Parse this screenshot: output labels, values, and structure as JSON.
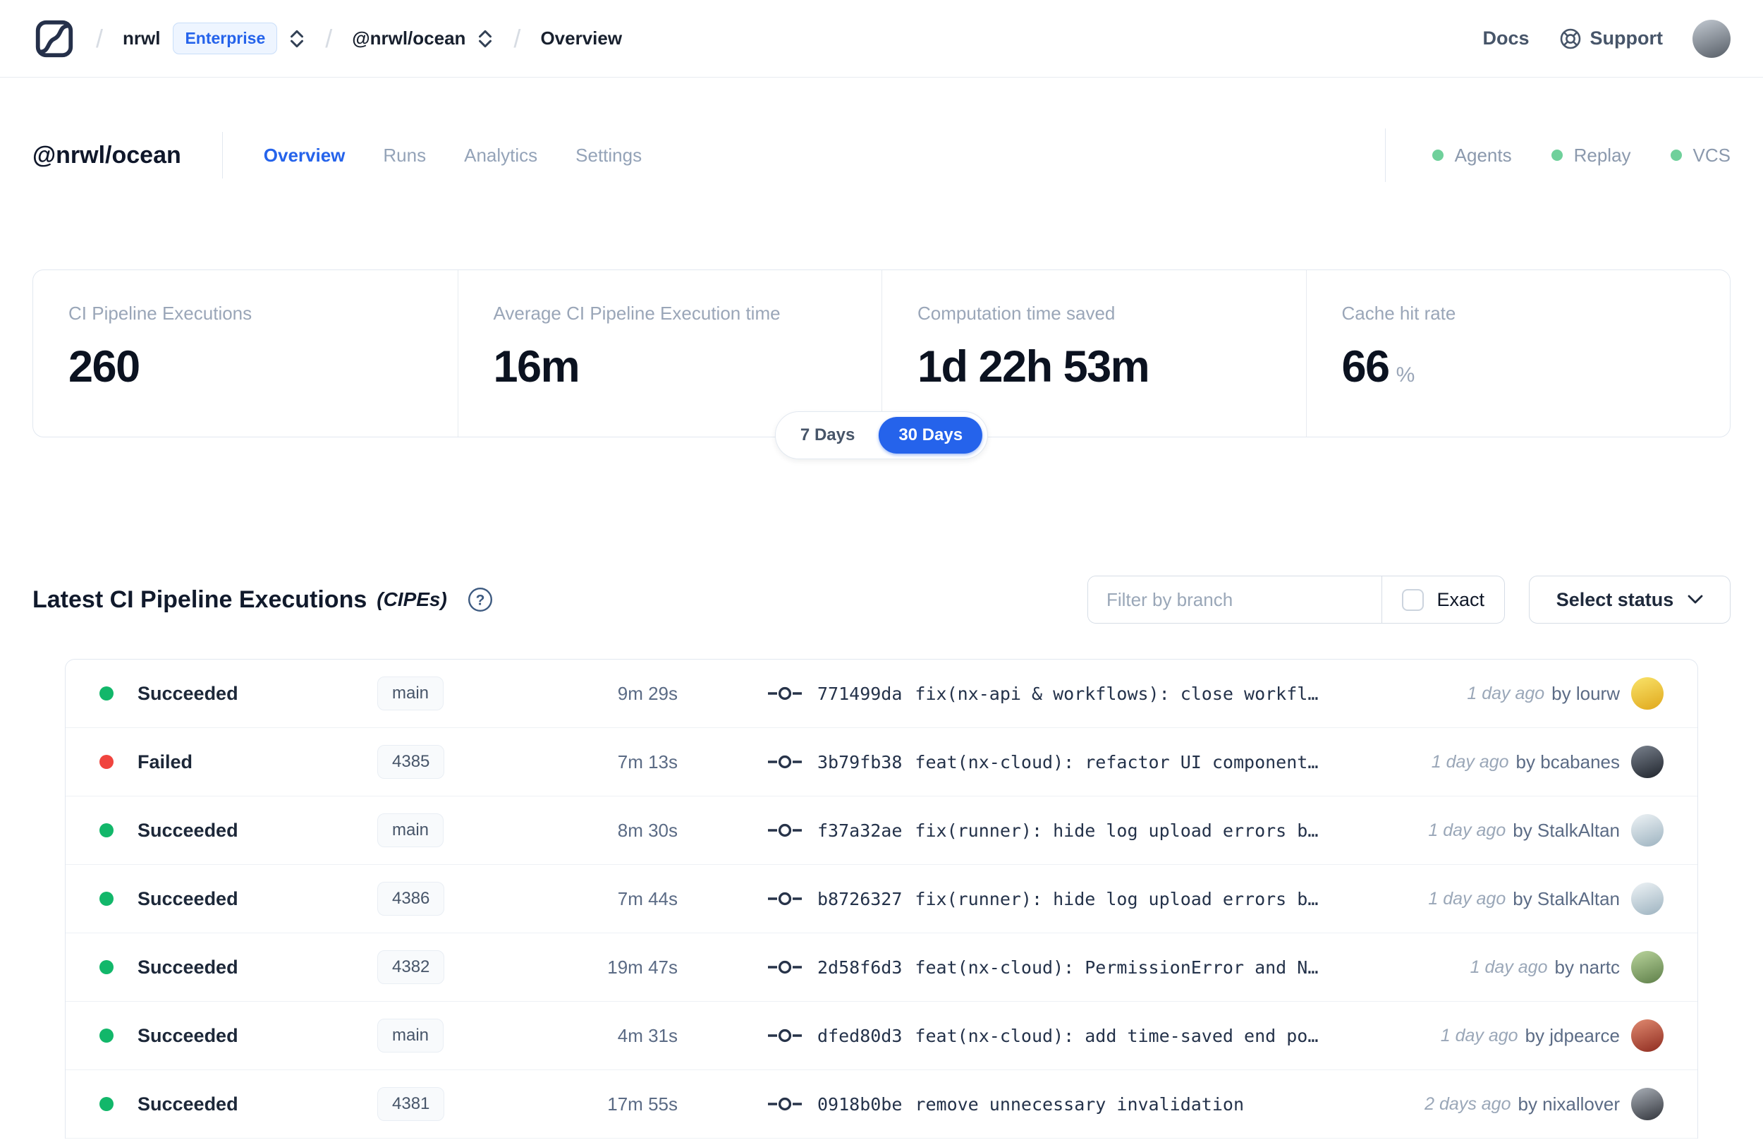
{
  "topbar": {
    "breadcrumb": {
      "separator": "/",
      "org": "nrwl",
      "plan_badge": "Enterprise",
      "workspace": "@nrwl/ocean",
      "page": "Overview"
    },
    "docs_label": "Docs",
    "support_label": "Support",
    "user_avatar_colors": [
      "#c3cad2",
      "#565d66"
    ]
  },
  "workspace_header": {
    "title": "@nrwl/ocean",
    "tabs": [
      {
        "label": "Overview",
        "active": true
      },
      {
        "label": "Runs",
        "active": false
      },
      {
        "label": "Analytics",
        "active": false
      },
      {
        "label": "Settings",
        "active": false
      }
    ],
    "features": [
      {
        "label": "Agents"
      },
      {
        "label": "Replay"
      },
      {
        "label": "VCS"
      }
    ],
    "feature_dot_color": "#6fd09b"
  },
  "stats": {
    "cards": [
      {
        "label": "CI Pipeline Executions",
        "value": "260",
        "suffix": ""
      },
      {
        "label": "Average CI Pipeline Execution time",
        "value": "16m",
        "suffix": ""
      },
      {
        "label": "Computation time saved",
        "value": "1d 22h 53m",
        "suffix": ""
      },
      {
        "label": "Cache hit rate",
        "value": "66",
        "suffix": "%"
      }
    ],
    "range_toggle": {
      "options": [
        "7 Days",
        "30 Days"
      ],
      "selected": "30 Days"
    }
  },
  "cipe_section": {
    "title": "Latest CI Pipeline Executions",
    "title_suffix": "(CIPEs)",
    "filter": {
      "branch_placeholder": "Filter by branch",
      "exact_label": "Exact",
      "exact_checked": false,
      "status_button_label": "Select status"
    },
    "rows": [
      {
        "status": "Succeeded",
        "status_color": "#12b76a",
        "branch": "main",
        "duration": "9m 29s",
        "commit_hash": "771499da",
        "commit_message": "fix(nx-api & workflows): close workfl…",
        "time_ago": "1 day ago",
        "author": "by lourw",
        "avatar_colors": [
          "#f9e36a",
          "#e0a81c"
        ]
      },
      {
        "status": "Failed",
        "status_color": "#f0443e",
        "branch": "4385",
        "duration": "7m 13s",
        "commit_hash": "3b79fb38",
        "commit_message": "feat(nx-cloud): refactor UI component…",
        "time_ago": "1 day ago",
        "author": "by bcabanes",
        "avatar_colors": [
          "#7a828e",
          "#1f242c"
        ]
      },
      {
        "status": "Succeeded",
        "status_color": "#12b76a",
        "branch": "main",
        "duration": "8m 30s",
        "commit_hash": "f37a32ae",
        "commit_message": "fix(runner): hide log upload errors b…",
        "time_ago": "1 day ago",
        "author": "by StalkAltan",
        "avatar_colors": [
          "#eef3f6",
          "#9db3c0"
        ]
      },
      {
        "status": "Succeeded",
        "status_color": "#12b76a",
        "branch": "4386",
        "duration": "7m 44s",
        "commit_hash": "b8726327",
        "commit_message": "fix(runner): hide log upload errors b…",
        "time_ago": "1 day ago",
        "author": "by StalkAltan",
        "avatar_colors": [
          "#eef3f6",
          "#9db3c0"
        ]
      },
      {
        "status": "Succeeded",
        "status_color": "#12b76a",
        "branch": "4382",
        "duration": "19m 47s",
        "commit_hash": "2d58f6d3",
        "commit_message": "feat(nx-cloud): PermissionError and N…",
        "time_ago": "1 day ago",
        "author": "by nartc",
        "avatar_colors": [
          "#b9d49c",
          "#5e7f49"
        ]
      },
      {
        "status": "Succeeded",
        "status_color": "#12b76a",
        "branch": "main",
        "duration": "4m 31s",
        "commit_hash": "dfed80d3",
        "commit_message": "feat(nx-cloud): add time-saved end po…",
        "time_ago": "1 day ago",
        "author": "by jdpearce",
        "avatar_colors": [
          "#e08a70",
          "#8f2c20"
        ]
      },
      {
        "status": "Succeeded",
        "status_color": "#12b76a",
        "branch": "4381",
        "duration": "17m 55s",
        "commit_hash": "0918b0be",
        "commit_message": "remove unnecessary invalidation",
        "time_ago": "2 days ago",
        "author": "by nixallover",
        "avatar_colors": [
          "#aab0b8",
          "#32353c"
        ]
      }
    ]
  },
  "colors": {
    "accent_blue": "#2563eb",
    "success_green": "#12b76a",
    "failed_red": "#f0443e",
    "nav_dot_green": "#6fd09b"
  }
}
